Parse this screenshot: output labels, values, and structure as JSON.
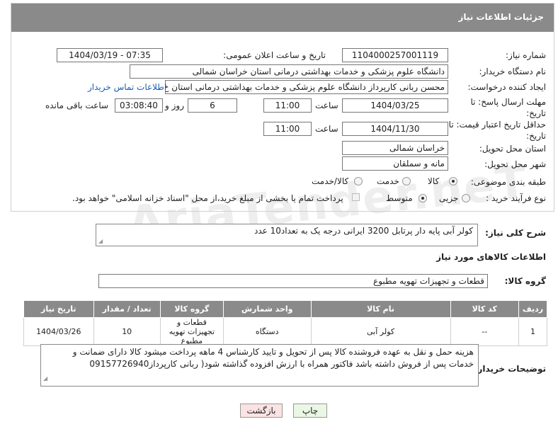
{
  "header": {
    "title": "جزئیات اطلاعات نیاز"
  },
  "watermark": "AriaTender.neT",
  "fields": {
    "need_number": {
      "label": "شماره نیاز:",
      "value": "1104000257001119"
    },
    "announce": {
      "label": "تاریخ و ساعت اعلان عمومی:",
      "value": "1404/03/19 - 07:35"
    },
    "buyer_org": {
      "label": "نام دستگاه خریدار:",
      "value": "دانشگاه علوم پزشکی و خدمات بهداشتی درمانی استان خراسان شمالی"
    },
    "requester": {
      "label": "ایجاد کننده درخواست:",
      "value": "محسن ربانی کارپرداز دانشگاه علوم پزشکی و خدمات بهداشتی درمانی استان خ",
      "link": "اطلاعات تماس خریدار"
    },
    "deadline": {
      "label": "مهلت ارسال پاسخ: تا تاریخ:",
      "date": "1404/03/25",
      "time_label": "ساعت",
      "time": "11:00",
      "days": "6",
      "days_label": "روز و",
      "remaining": "03:08:40",
      "remaining_label": "ساعت باقی مانده"
    },
    "price_validity": {
      "label": "حداقل تاریخ اعتبار قیمت: تا تاریخ:",
      "date": "1404/11/30",
      "time_label": "ساعت",
      "time": "11:00"
    },
    "province": {
      "label": "استان محل تحویل:",
      "value": "خراسان شمالی"
    },
    "city": {
      "label": "شهر محل تحویل:",
      "value": "مانه و سملقان"
    },
    "category": {
      "label": "طبقه بندی موضوعی:",
      "options": [
        "کالا",
        "خدمت",
        "کالا/خدمت"
      ],
      "selected": "کالا"
    },
    "process": {
      "label": "نوع فرآیند خرید :",
      "options": [
        "جزیی",
        "متوسط"
      ],
      "selected": "متوسط",
      "payment_note": "پرداخت تمام یا بخشی از مبلغ خرید،از محل \"اسناد خزانه اسلامی\" خواهد بود."
    }
  },
  "description": {
    "label": "شرح کلی نیاز:",
    "value": "کولر آبی پایه دار پرتابل 3200 ایرانی درجه یک به تعداد10 عدد"
  },
  "goods_section": {
    "title": "اطلاعات کالاهای مورد نیاز"
  },
  "goods_group": {
    "label": "گروه کالا:",
    "value": "قطعات و تجهیزات تهویه مطبوع"
  },
  "table": {
    "headers": [
      "ردیف",
      "کد کالا",
      "نام کالا",
      "واحد شمارش",
      "گروه کالا",
      "تعداد / مقدار",
      "تاریخ نیاز"
    ],
    "rows": [
      [
        "1",
        "--",
        "کولر آبی",
        "دستگاه",
        "قطعات و تجهیزات تهویه مطبوع",
        "10",
        "1404/03/26"
      ]
    ]
  },
  "buyer_notes": {
    "label": "توضیحات خریدار:",
    "value": "هزینه حمل و نقل به عهده فروشنده کالا پس از تحویل و تایید کارشناس 4 ماهه پرداخت میشود کالا دارای ضمانت و خدمات پس از فروش داشته باشد فاکتور همراه با ارزش افزوده گذاشته شود( ربانی کارپرداز09157726940"
  },
  "buttons": {
    "print": "چاپ",
    "back": "بازگشت"
  },
  "colors": {
    "header_bg": "#8a8a8a",
    "link": "#1a5fb4",
    "print_btn": "#eaf7e4",
    "back_btn": "#fbe3e3"
  }
}
